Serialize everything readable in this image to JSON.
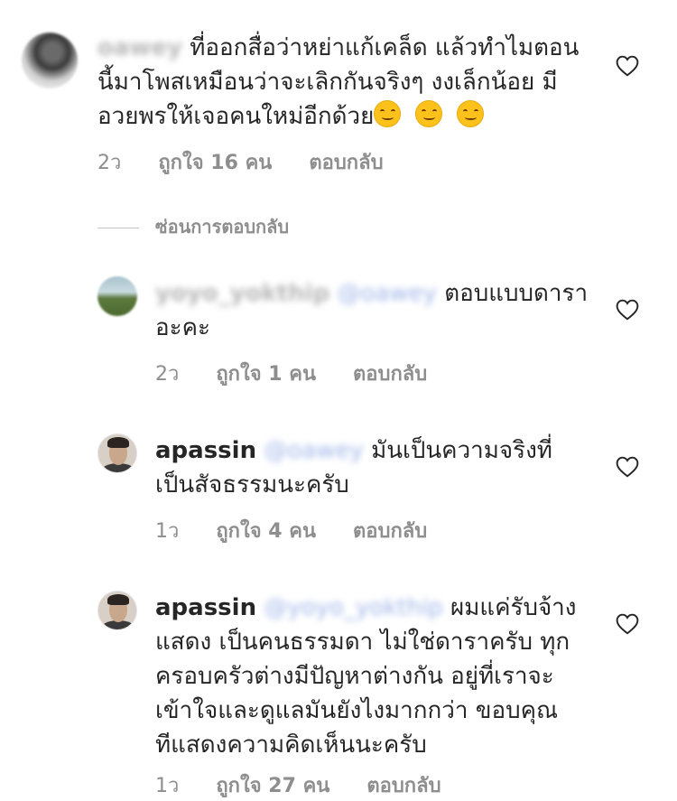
{
  "comment_main": {
    "username": "oawey",
    "text_lines": [
      "ที่ออกสื่อว่าหย่าแก้เคล็ด แล้วทำไมตอน",
      "นี้มาโพสเหมือนว่าจะเลิกกันจริงๆ งงเล็กน้อย มี",
      "อวยพรให้เจอคนใหม่อีกด้วย"
    ],
    "emojis": [
      "smiling-face-emoji",
      "smiling-face-emoji",
      "smiling-face-emoji"
    ],
    "time": "2ว",
    "likes": "ถูกใจ 16 คน",
    "reply": "ตอบกลับ"
  },
  "hide_replies": "ซ่อนการตอบกลับ",
  "replies": [
    {
      "username": "yoyo_yokthip",
      "mention": "@oawey",
      "text_lines": [
        "ตอบแบบดารา",
        "อะคะ"
      ],
      "time": "2ว",
      "likes": "ถูกใจ 1 คน",
      "reply": "ตอบกลับ"
    },
    {
      "username": "apassin",
      "mention": "@oawey",
      "text_lines": [
        "มันเป็นความจริงที่",
        "เป็นสัจธรรมนะครับ"
      ],
      "time": "1ว",
      "likes": "ถูกใจ 4 คน",
      "reply": "ตอบกลับ"
    },
    {
      "username": "apassin",
      "mention": "@yoyo_yokthip",
      "text_lines": [
        "ผมแค่รับจ้าง",
        "แสดง เป็นคนธรรมดา ไม่ใช่ดาราครับ ทุก",
        "ครอบครัวต่างมีปัญหาต่างกัน อยู่ที่เราจะ",
        "เข้าใจและดูแลมันยังไงมากกว่า ขอบคุณ",
        "ทีแสดงความคิดเห็นนะครับ"
      ],
      "time": "1ว",
      "likes": "ถูกใจ 27 คน",
      "reply": "ตอบกลับ"
    }
  ],
  "icons": {
    "heart": "heart-outline-icon",
    "emoji": "smiling-face-emoji"
  },
  "colors": {
    "text": "#262626",
    "meta": "#8e8e8e",
    "divider": "#c7c7c7"
  }
}
